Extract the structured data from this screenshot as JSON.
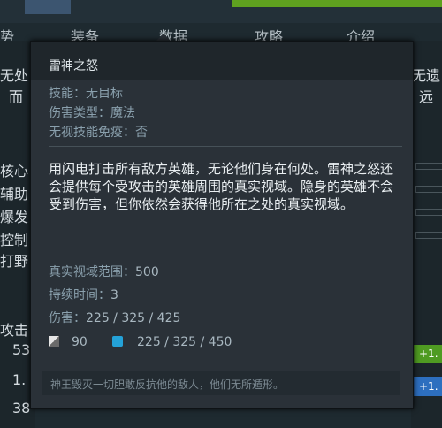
{
  "background": {
    "nav": [
      "势",
      "装备",
      "数据",
      "攻略",
      "介绍"
    ],
    "left_fragments": [
      "无处",
      "而",
      "核心",
      "辅助",
      "爆发",
      "控制",
      "打野",
      "攻击",
      "53",
      "1.",
      "38"
    ],
    "right_fragments": [
      "无遗",
      "远"
    ],
    "buttons": [
      "+1.",
      "+1."
    ]
  },
  "tooltip": {
    "title": "雷神之怒",
    "meta": [
      "技能：无目标",
      "伤害类型：魔法",
      "无视技能免疫：否"
    ],
    "description": "用闪电打击所有敌方英雄，无论他们身在何处。雷神之怒还会提供每个受攻击的英雄周围的真实视域。隐身的英雄不会受到伤害，但你依然会获得他所在之处的真实视域。",
    "stats": [
      {
        "label": "真实视域范围：",
        "value": "500"
      },
      {
        "label": "持续时间：",
        "value": "3"
      },
      {
        "label": "伤害：",
        "value": "225 / 325 / 425"
      }
    ],
    "cooldown": "90",
    "mana": "225 / 325 / 450",
    "lore": "神王毁灭一切胆敢反抗他的敌人，他们无所遁形。"
  },
  "colors": {
    "mana": "#24a2d8",
    "accent_green": "#5fa11f",
    "accent_blue": "#2d6fbf"
  }
}
